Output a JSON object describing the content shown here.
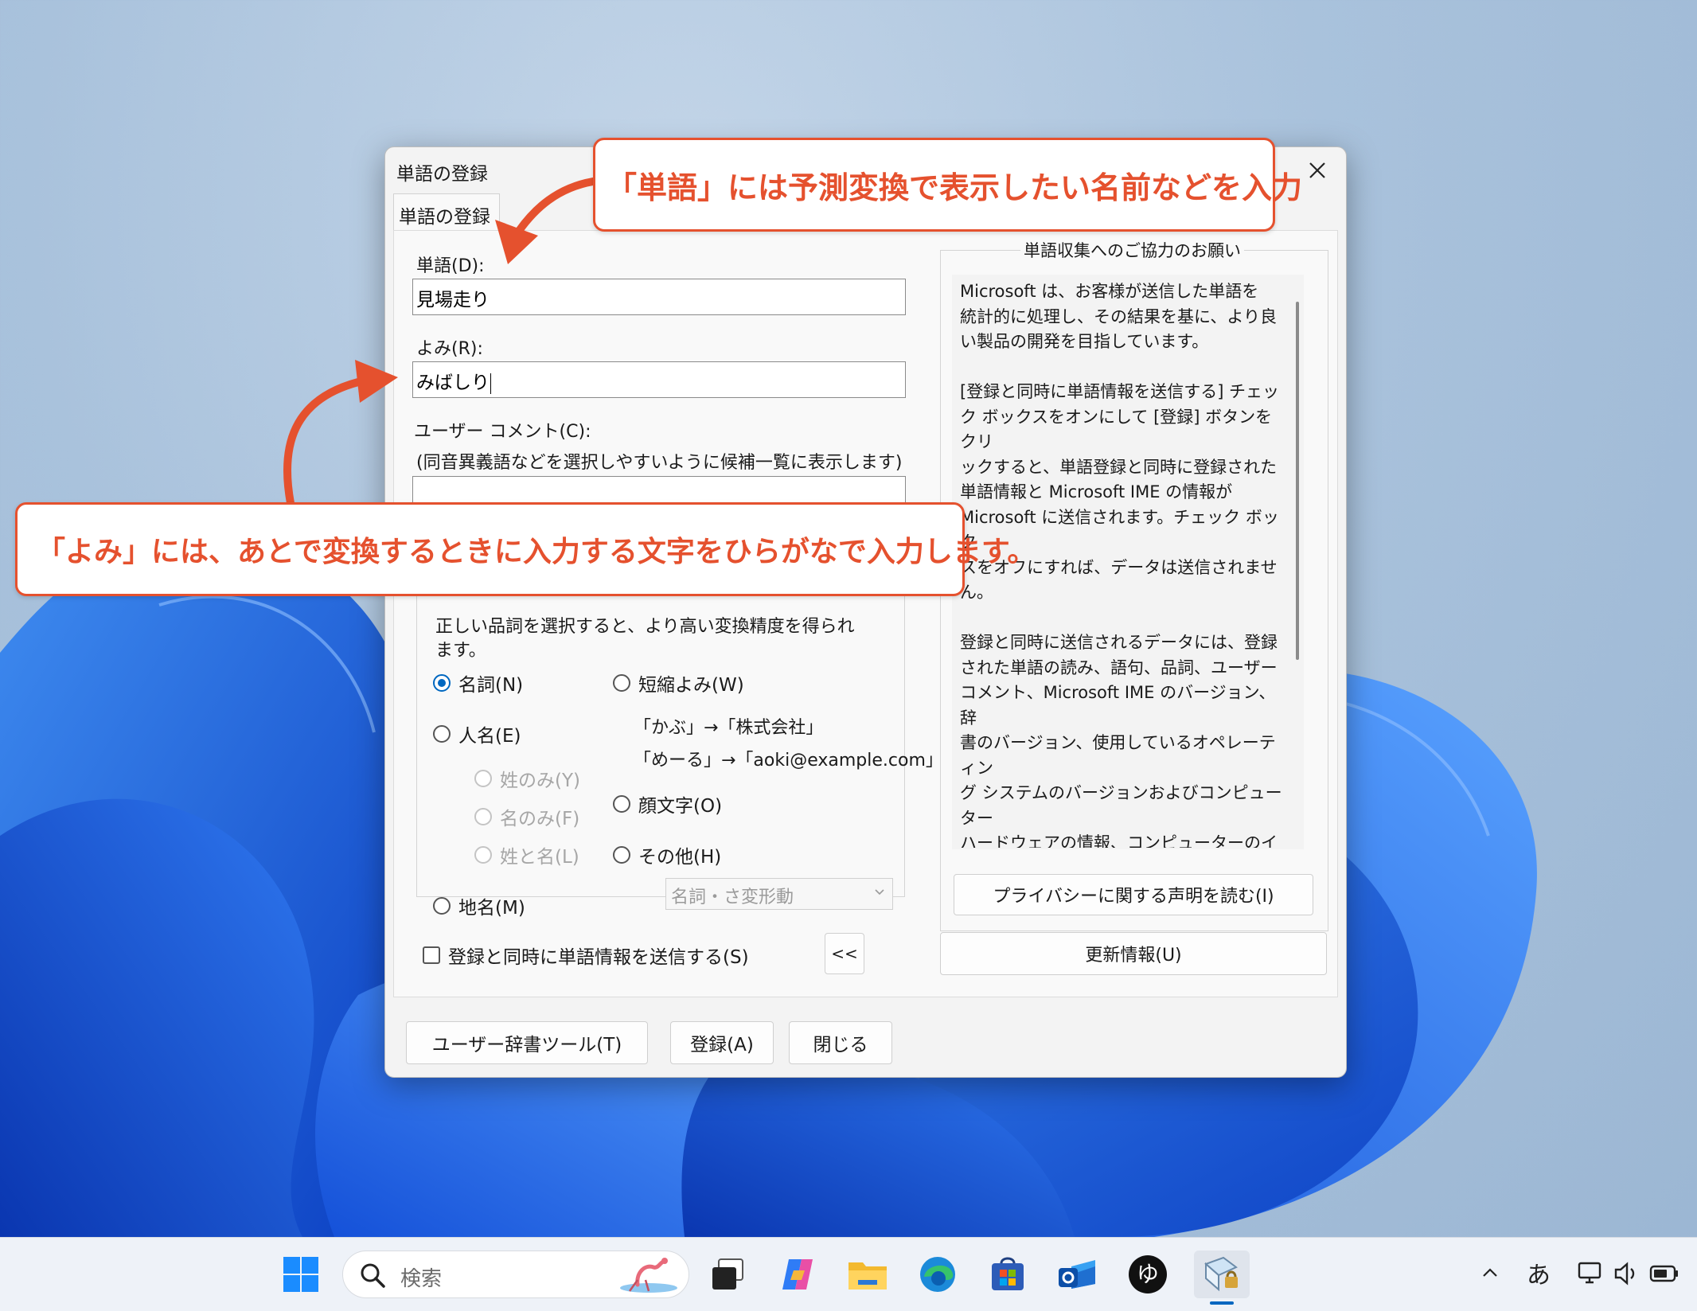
{
  "dialog": {
    "title": "単語の登録",
    "tab_label": "単語の登録",
    "word_label": "単語(D):",
    "word_value": "見場走り",
    "reading_label": "よみ(R):",
    "reading_value": "みばしり",
    "comment_label": "ユーザー コメント(C):",
    "comment_hint": "(同音異義語などを選択しやすいように候補一覧に表示します)",
    "comment_value": "",
    "pos_hint": "正しい品詞を選択すると、より高い変換精度を得られます。",
    "pos_options": {
      "noun": "名詞(N)",
      "person": "人名(E)",
      "surname": "姓のみ(Y)",
      "given": "名のみ(F)",
      "full": "姓と名(L)",
      "place": "地名(M)",
      "short": "短縮よみ(W)",
      "emoticon": "顔文字(O)",
      "other": "その他(H)"
    },
    "short_example_1": "「かぶ」→「株式会社」",
    "short_example_2": "「めーる」→「aoki@example.com」",
    "selected_pos": "名詞(N)",
    "subtype_select": "名詞・さ変形動",
    "send_checkbox": "登録と同時に単語情報を送信する(S)",
    "collapse_button": "<<",
    "info_group_title": "単語収集へのご協力のお願い",
    "info_text": "Microsoft は、お客様が送信した単語を\n統計的に処理し、その結果を基に、より良\nい製品の開発を目指しています。\n\n[登録と同時に単語情報を送信する] チェッ\nク ボックスをオンにして [登録] ボタンをクリ\nックすると、単語登録と同時に登録された\n単語情報と Microsoft IME の情報が\nMicrosoft に送信されます。チェック ボック\nスをオフにすれば、データは送信されません。\n\n登録と同時に送信されるデータには、登録\nされた単語の読み、語句、品詞、ユーザー\nコメント、Microsoft IME のバージョン、辞\n書のバージョン、使用しているオペレーティン\nグ システムのバージョンおよびコンピューター\nハードウェアの情報、コンピューターのインター\nネット プロトコル (IP) アドレスが含まれます。\n\nお客様特有の情報が収集されたデータに含\nまれることがあります。このような情報が存\n在する場合でも、Microsoft では、お客様\nを特定するために使用することはありません。",
    "privacy_button": "プライバシーに関する声明を読む(I)",
    "update_button": "更新情報(U)",
    "user_dict_button": "ユーザー辞書ツール(T)",
    "register_button": "登録(A)",
    "close_button": "閉じる"
  },
  "annotations": {
    "word_callout": "「単語」には予測変換で表示したい名前などを入力",
    "reading_callout": "「よみ」には、あとで変換するときに入力する文字をひらがなで入力します。",
    "color": "#e5512e"
  },
  "taskbar": {
    "search_placeholder": "検索",
    "ime_mode": "あ",
    "icons": [
      "start-icon",
      "task-view-icon",
      "copilot-icon",
      "file-explorer-icon",
      "edge-icon",
      "store-icon",
      "outlook-icon",
      "ime-app-icon",
      "dictionary-tool-icon"
    ]
  },
  "colors": {
    "accent": "#0067c0",
    "annotation": "#e5512e"
  }
}
